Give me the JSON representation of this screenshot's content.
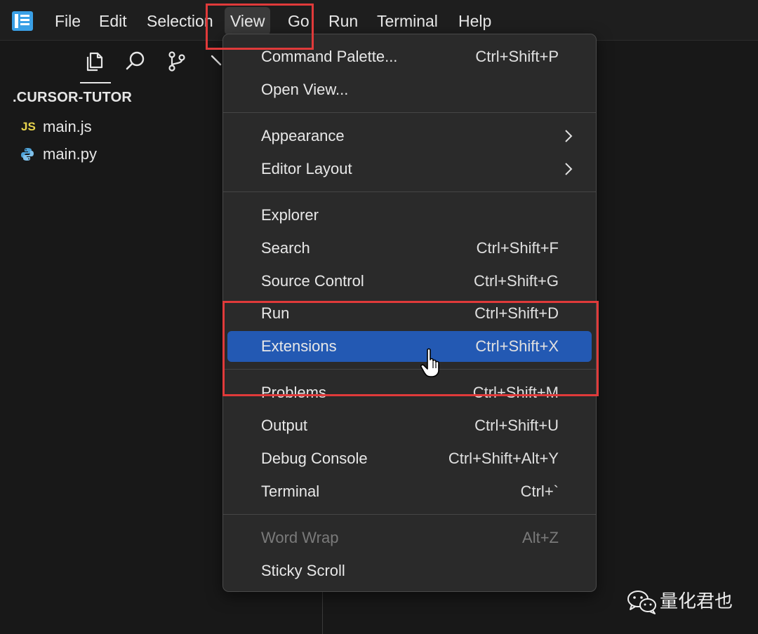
{
  "menubar": {
    "items": [
      {
        "label": "File"
      },
      {
        "label": "Edit"
      },
      {
        "label": "Selection"
      },
      {
        "label": "View"
      },
      {
        "label": "Go"
      },
      {
        "label": "Run"
      },
      {
        "label": "Terminal"
      },
      {
        "label": "Help"
      }
    ],
    "active": "View"
  },
  "activity_bar": {
    "icons": [
      "files-icon",
      "search-icon",
      "source-control-icon",
      "debug-icon"
    ]
  },
  "explorer": {
    "title": ".CURSOR-TUTOR",
    "files": [
      {
        "icon_text": "JS",
        "name": "main.js"
      },
      {
        "name": "main.py"
      }
    ]
  },
  "view_menu": {
    "groups": [
      [
        {
          "label": "Command Palette...",
          "shortcut": "Ctrl+Shift+P"
        },
        {
          "label": "Open View...",
          "shortcut": ""
        }
      ],
      [
        {
          "label": "Appearance",
          "submenu": true
        },
        {
          "label": "Editor Layout",
          "submenu": true
        }
      ],
      [
        {
          "label": "Explorer",
          "shortcut": ""
        },
        {
          "label": "Search",
          "shortcut": "Ctrl+Shift+F"
        },
        {
          "label": "Source Control",
          "shortcut": "Ctrl+Shift+G"
        },
        {
          "label": "Run",
          "shortcut": "Ctrl+Shift+D"
        },
        {
          "label": "Extensions",
          "shortcut": "Ctrl+Shift+X",
          "highlighted": true
        }
      ],
      [
        {
          "label": "Problems",
          "shortcut": "Ctrl+Shift+M"
        },
        {
          "label": "Output",
          "shortcut": "Ctrl+Shift+U"
        },
        {
          "label": "Debug Console",
          "shortcut": "Ctrl+Shift+Alt+Y"
        },
        {
          "label": "Terminal",
          "shortcut": "Ctrl+`"
        }
      ],
      [
        {
          "label": "Word Wrap",
          "shortcut": "Alt+Z",
          "disabled": true
        },
        {
          "label": "Sticky Scroll",
          "shortcut": ""
        }
      ]
    ]
  },
  "colors": {
    "highlight": "#2359b3",
    "annotation": "#e03a3a",
    "js_icon": "#e8d44d",
    "py_icon": "#4fa3d9"
  },
  "watermark": {
    "text": "量化君也"
  }
}
